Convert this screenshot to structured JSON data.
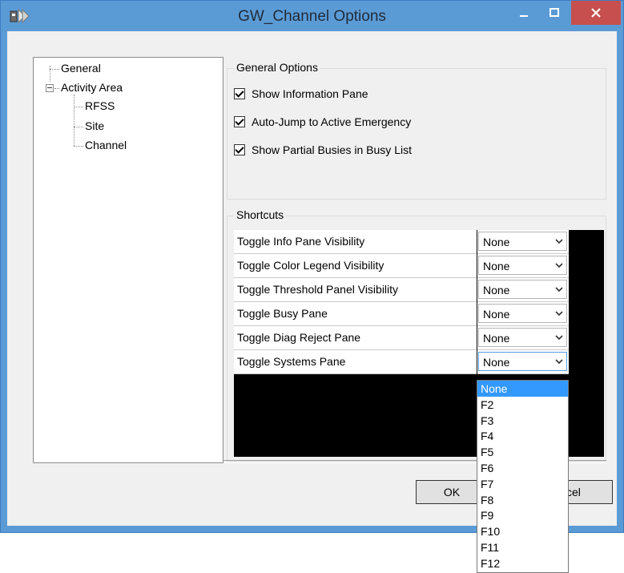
{
  "window": {
    "title": "GW_Channel Options"
  },
  "tree": {
    "items": [
      {
        "label": "General"
      },
      {
        "label": "Activity Area"
      },
      {
        "label": "RFSS"
      },
      {
        "label": "Site"
      },
      {
        "label": "Channel"
      }
    ]
  },
  "general_options": {
    "title": "General Options",
    "options": [
      {
        "label": "Show Information Pane",
        "checked": true
      },
      {
        "label": "Auto-Jump to Active Emergency",
        "checked": true
      },
      {
        "label": "Show Partial Busies in Busy List",
        "checked": true
      }
    ]
  },
  "shortcuts": {
    "title": "Shortcuts",
    "rows": [
      {
        "label": "Toggle Info Pane Visibility",
        "value": "None"
      },
      {
        "label": "Toggle Color Legend Visibility",
        "value": "None"
      },
      {
        "label": "Toggle Threshold Panel Visibility",
        "value": "None"
      },
      {
        "label": "Toggle Busy Pane",
        "value": "None"
      },
      {
        "label": "Toggle Diag Reject Pane",
        "value": "None"
      },
      {
        "label": "Toggle Systems Pane",
        "value": "None"
      }
    ]
  },
  "buttons": {
    "ok": "OK",
    "cancel_partial": "cel"
  },
  "dropdown": {
    "options": [
      "None",
      "F2",
      "F3",
      "F4",
      "F5",
      "F6",
      "F7",
      "F8",
      "F9",
      "F10",
      "F11",
      "F12"
    ],
    "selected": "None"
  },
  "colors": {
    "title_bar": "#5b9bd5",
    "close_button": "#c7504e",
    "selection": "#3399ff"
  }
}
